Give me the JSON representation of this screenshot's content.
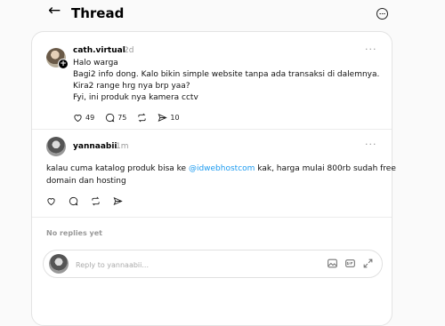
{
  "header": {
    "back_glyph": "←",
    "title": "Thread"
  },
  "post": {
    "username": "cath.virtual",
    "time": "2d",
    "lines": [
      "Halo warga",
      "Bagi2 info dong. Kalo bikin simple website tanpa ada transaksi di dalemnya.",
      "Kira2 range hrg nya brp yaa?",
      "Fyi, ini produk nya kamera cctv"
    ],
    "likes": "49",
    "comments": "75",
    "shares": "10",
    "more": "···"
  },
  "reply": {
    "username": "yannaabii",
    "time": "1m",
    "text_before": "kalau cuma katalog produk bisa ke",
    "mention": "@idwebhostcom",
    "text_after": "kak, harga mulai 800rb sudah free",
    "text_line2": "domain dan hosting",
    "more": "···"
  },
  "no_replies": "No replies yet",
  "composer": {
    "placeholder": "Reply to yannaabii..."
  }
}
